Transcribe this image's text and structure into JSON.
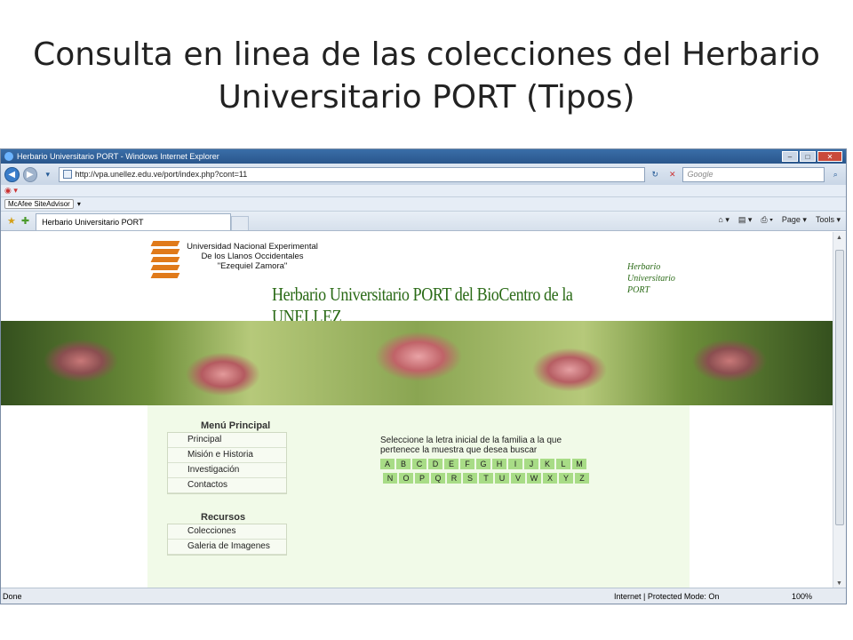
{
  "slide": {
    "title": "Consulta en linea de las colecciones del Herbario Universitario PORT (Tipos)"
  },
  "browser": {
    "window_title": "Herbario Universitario PORT - Windows Internet Explorer",
    "url": "http://vpa.unellez.edu.ve/port/index.php?cont=11",
    "search_placeholder": "Google",
    "mcafee_label": "McAfee SiteAdvisor",
    "tab_title": "Herbario Universitario PORT",
    "cmd_page": "Page",
    "cmd_tools": "Tools",
    "status_left": "Done",
    "status_mode": "Internet | Protected Mode: On",
    "zoom": "100%"
  },
  "site": {
    "university": "Universidad Nacional Experimental De los Llanos Occidentales \"Ezequiel Zamora\"",
    "university_line1": "Universidad Nacional Experimental",
    "university_line2": "De los Llanos Occidentales",
    "university_line3": "\"Ezequiel Zamora\"",
    "banner_title": "Herbario Universitario PORT del BioCentro de la UNELLEZ",
    "side_logo_line1": "Herbario",
    "side_logo_line2": "Universitario",
    "side_logo_line3": "PORT"
  },
  "menu": {
    "heading": "Menú Principal",
    "items": [
      "Principal",
      "Misión e Historia",
      "Investigación",
      "Contactos"
    ]
  },
  "resources": {
    "heading": "Recursos",
    "items": [
      "Colecciones",
      "Galeria de Imagenes"
    ]
  },
  "search_letters": {
    "instruction": "Seleccione la letra inicial de la familia a la que pertenece la muestra que desea buscar",
    "row1": [
      "A",
      "B",
      "C",
      "D",
      "E",
      "F",
      "G",
      "H",
      "I",
      "J",
      "K",
      "L",
      "M"
    ],
    "row2": [
      "N",
      "O",
      "P",
      "Q",
      "R",
      "S",
      "T",
      "U",
      "V",
      "W",
      "X",
      "Y",
      "Z"
    ]
  }
}
